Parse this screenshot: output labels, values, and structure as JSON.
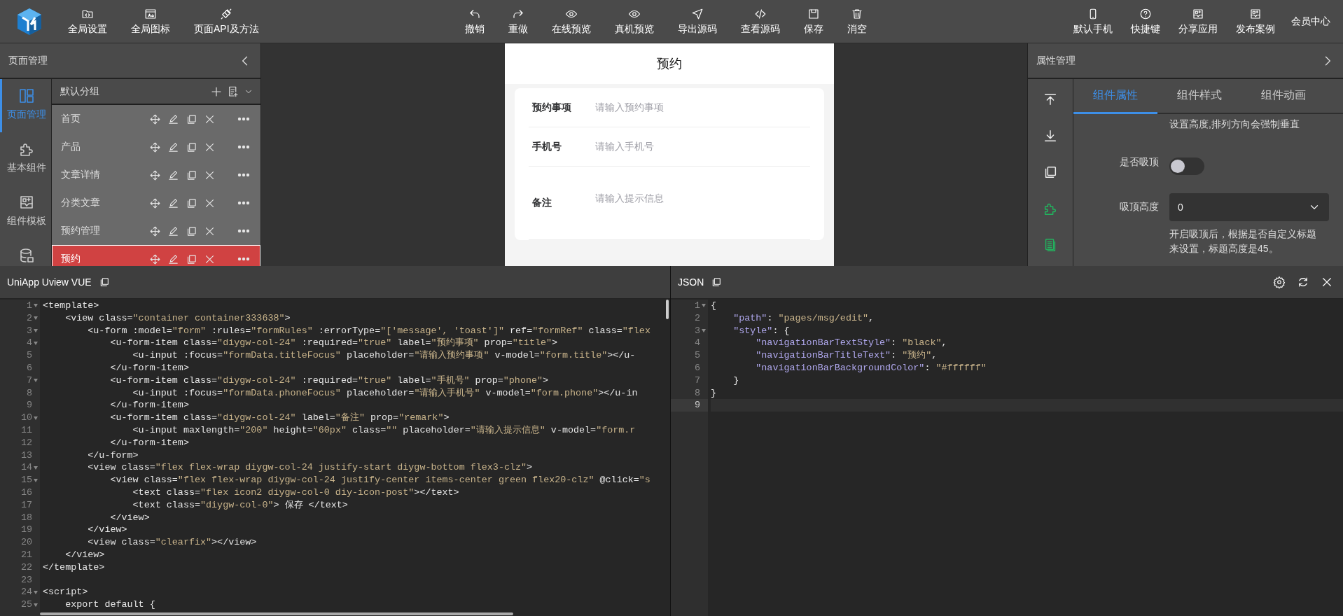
{
  "toolbar": {
    "left_buttons": [
      "全局设置",
      "全局图标",
      "页面API及方法"
    ],
    "center_buttons": [
      "撤销",
      "重做",
      "在线预览",
      "真机预览",
      "导出源码",
      "查看源码",
      "保存",
      "消空"
    ],
    "right_buttons": [
      "默认手机",
      "快捷键",
      "分享应用",
      "发布案例"
    ],
    "member_link": "会员中心"
  },
  "page_panel": {
    "title": "页面管理",
    "nav": [
      {
        "label": "页面管理",
        "selected": true
      },
      {
        "label": "基本组件",
        "selected": false
      },
      {
        "label": "组件模板",
        "selected": false
      },
      {
        "selected": false
      }
    ],
    "group": {
      "title": "默认分组"
    },
    "pages": [
      {
        "name": "首页",
        "selected": false
      },
      {
        "name": "产品",
        "selected": false
      },
      {
        "name": "文章详情",
        "selected": false
      },
      {
        "name": "分类文章",
        "selected": false
      },
      {
        "name": "预约管理",
        "selected": false
      },
      {
        "name": "预约",
        "selected": true
      }
    ]
  },
  "preview": {
    "title": "预约",
    "fields": [
      {
        "kind": "input",
        "label": "预约事项",
        "placeholder": "请输入预约事项"
      },
      {
        "kind": "input",
        "label": "手机号",
        "placeholder": "请输入手机号"
      },
      {
        "kind": "textarea",
        "label": "备注",
        "placeholder": "请输入提示信息"
      }
    ]
  },
  "property_panel": {
    "title": "属性管理",
    "tabs": [
      {
        "label": "组件属性",
        "selected": true
      },
      {
        "label": "组件样式",
        "selected": false
      },
      {
        "label": "组件动画",
        "selected": false
      }
    ],
    "note": "设置高度,排列方向会强制垂直",
    "sticky": {
      "label": "是否吸顶",
      "on": false
    },
    "sticky_height": {
      "label": "吸顶高度",
      "value": "0",
      "help": "开启吸顶后，根据是否自定义标题来设置，标题高度是45。"
    }
  },
  "code_editor": {
    "title": "UniApp Uview VUE",
    "lines": [
      {
        "number": "1",
        "fold": true,
        "text": "<template>"
      },
      {
        "number": "2",
        "fold": true,
        "text": "    <view class=\"container container333638\">"
      },
      {
        "number": "3",
        "fold": true,
        "text": "        <u-form :model=\"form\" :rules=\"formRules\" :errorType=\"['message', 'toast']\" ref=\"formRef\" class=\"flex"
      },
      {
        "number": "4",
        "fold": true,
        "text": "            <u-form-item class=\"diygw-col-24\" :required=\"true\" label=\"预约事项\" prop=\"title\">"
      },
      {
        "number": "5",
        "fold": false,
        "text": "                <u-input :focus=\"formData.titleFocus\" placeholder=\"请输入预约事项\" v-model=\"form.title\"></u-"
      },
      {
        "number": "6",
        "fold": false,
        "text": "            </u-form-item>"
      },
      {
        "number": "7",
        "fold": true,
        "text": "            <u-form-item class=\"diygw-col-24\" :required=\"true\" label=\"手机号\" prop=\"phone\">"
      },
      {
        "number": "8",
        "fold": false,
        "text": "                <u-input :focus=\"formData.phoneFocus\" placeholder=\"请输入手机号\" v-model=\"form.phone\"></u-in"
      },
      {
        "number": "9",
        "fold": false,
        "text": "            </u-form-item>"
      },
      {
        "number": "10",
        "fold": true,
        "text": "            <u-form-item class=\"diygw-col-24\" label=\"备注\" prop=\"remark\">"
      },
      {
        "number": "11",
        "fold": false,
        "text": "                <u-input maxlength=\"200\" height=\"60px\" class=\"\" placeholder=\"请输入提示信息\" v-model=\"form.r"
      },
      {
        "number": "12",
        "fold": false,
        "text": "            </u-form-item>"
      },
      {
        "number": "13",
        "fold": false,
        "text": "        </u-form>"
      },
      {
        "number": "14",
        "fold": true,
        "text": "        <view class=\"flex flex-wrap diygw-col-24 justify-start diygw-bottom flex3-clz\">"
      },
      {
        "number": "15",
        "fold": true,
        "text": "            <view class=\"flex flex-wrap diygw-col-24 justify-center items-center green flex20-clz\" @click=\"s"
      },
      {
        "number": "16",
        "fold": false,
        "text": "                <text class=\"flex icon2 diygw-col-0 diy-icon-post\"></text>"
      },
      {
        "number": "17",
        "fold": false,
        "text": "                <text class=\"diygw-col-0\"> 保存 </text>"
      },
      {
        "number": "18",
        "fold": false,
        "text": "            </view>"
      },
      {
        "number": "19",
        "fold": false,
        "text": "        </view>"
      },
      {
        "number": "20",
        "fold": false,
        "text": "        <view class=\"clearfix\"></view>"
      },
      {
        "number": "21",
        "fold": false,
        "text": "    </view>"
      },
      {
        "number": "22",
        "fold": false,
        "text": "</template>"
      },
      {
        "number": "23",
        "fold": false
      },
      {
        "number": "24",
        "fold": true,
        "text": "<script>"
      },
      {
        "number": "25",
        "fold": true,
        "text": "    export default {"
      }
    ]
  },
  "json_editor": {
    "title": "JSON",
    "lines": [
      {
        "number": "1",
        "fold": true,
        "current": false,
        "text": "{"
      },
      {
        "number": "2",
        "fold": false,
        "current": false,
        "text": "    \"path\": \"pages/msg/edit\","
      },
      {
        "number": "3",
        "fold": true,
        "current": false,
        "text": "    \"style\": {"
      },
      {
        "number": "4",
        "fold": false,
        "current": false,
        "text": "        \"navigationBarTextStyle\": \"black\","
      },
      {
        "number": "5",
        "fold": false,
        "current": false,
        "text": "        \"navigationBarTitleText\": \"预约\","
      },
      {
        "number": "6",
        "fold": false,
        "current": false,
        "text": "        \"navigationBarBackgroundColor\": \"#ffffff\""
      },
      {
        "number": "7",
        "fold": false,
        "current": false,
        "text": "    }"
      },
      {
        "number": "8",
        "fold": false,
        "current": false,
        "text": "}"
      },
      {
        "number": "9",
        "fold": false,
        "current": true
      }
    ]
  }
}
